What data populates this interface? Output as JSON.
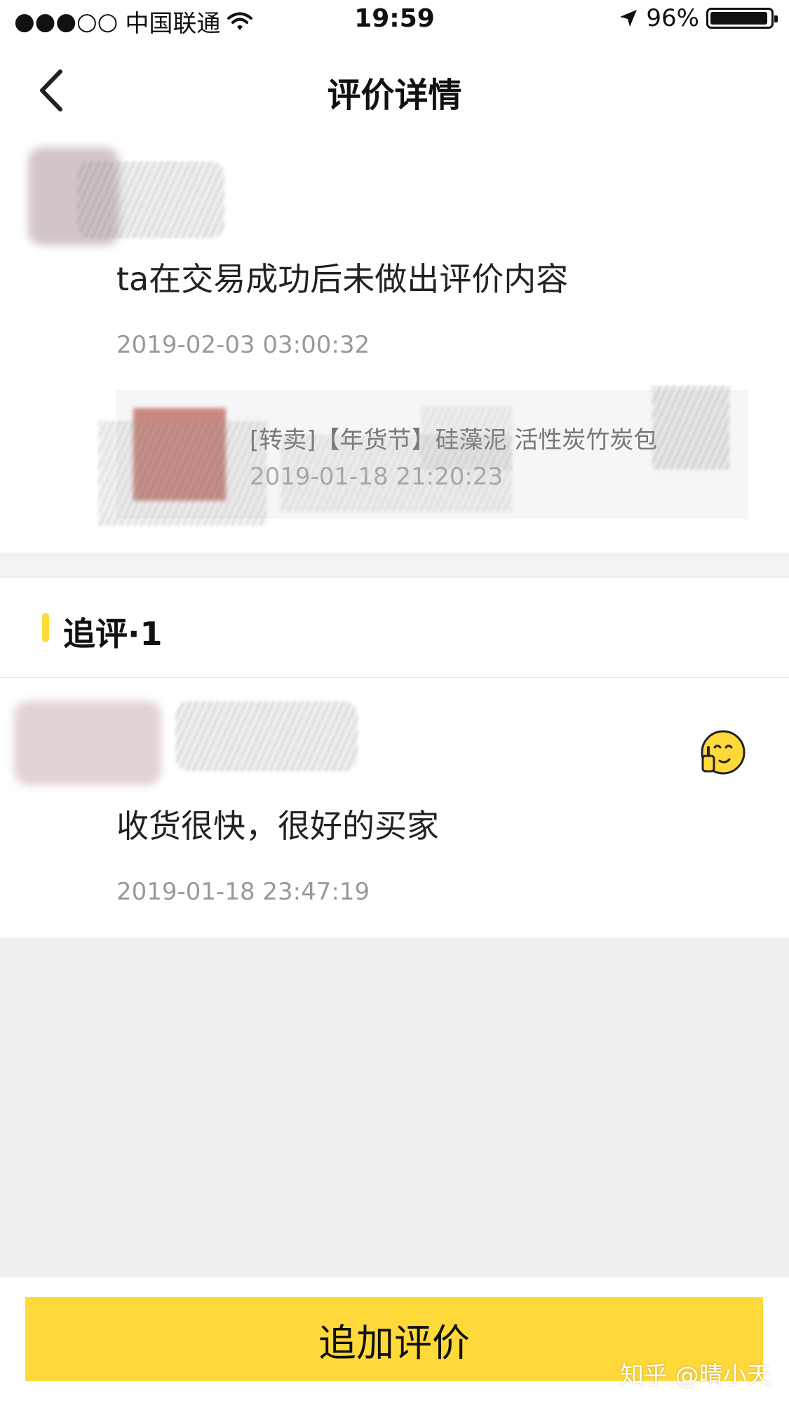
{
  "status_bar": {
    "signal": "●●●○○",
    "carrier": "中国联通",
    "time": "19:59",
    "battery": "96%",
    "battery_level": 0.96
  },
  "nav": {
    "title": "评价详情"
  },
  "review": {
    "text": "ta在交易成功后未做出评价内容",
    "time": "2019-02-03 03:00:32",
    "item": {
      "title": "[转卖]【年货节】硅藻泥 活性炭竹炭包",
      "time": "2019-01-18 21:20:23"
    }
  },
  "follow_up": {
    "title": "追评·1",
    "text": "收货很快，很好的买家",
    "time": "2019-01-18 23:47:19"
  },
  "action": {
    "label": "追加评价"
  },
  "watermark": "知乎 @晴小天",
  "colors": {
    "accent": "#ffd93a",
    "background_gray": "#efefef",
    "muted_text": "#999999"
  },
  "icons": {
    "back": "chevron-left-icon",
    "wifi": "wifi-icon",
    "location": "location-arrow-icon",
    "battery": "battery-icon",
    "emoji": "thinking-thumbs-up-emoji-icon"
  }
}
